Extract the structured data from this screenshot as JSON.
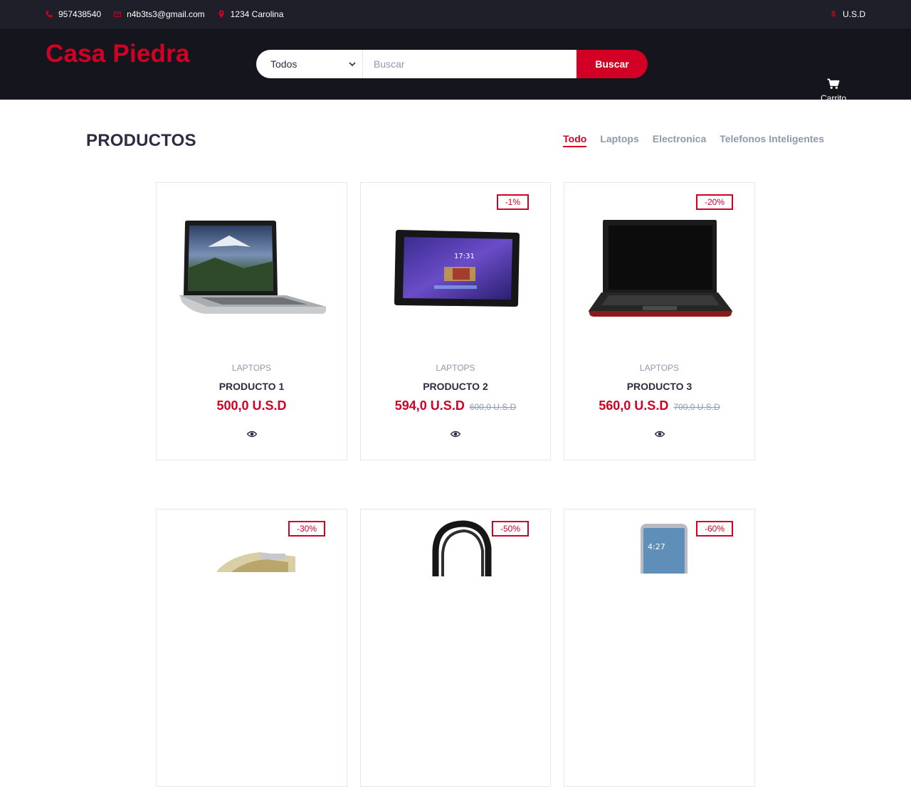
{
  "topbar": {
    "phone": "957438540",
    "email": "n4b3ts3@gmail.com",
    "address": "1234 Carolina",
    "currency": "U.S.D",
    "icons": {
      "phone": "phone-icon",
      "email": "envelope-icon",
      "address": "map-marker-icon",
      "currency": "dollar-icon"
    }
  },
  "header": {
    "logo": "Casa Piedra",
    "search": {
      "category_selected": "Todos",
      "placeholder": "Buscar",
      "value": "",
      "button_label": "Buscar"
    },
    "cart_label": "Carrito"
  },
  "section": {
    "title": "PRODUCTOS",
    "tabs": [
      {
        "label": "Todo",
        "active": true
      },
      {
        "label": "Laptops",
        "active": false
      },
      {
        "label": "Electronica",
        "active": false
      },
      {
        "label": "Telefonos Inteligentes",
        "active": false
      }
    ]
  },
  "products": [
    {
      "badge": "",
      "category": "LAPTOPS",
      "name": "PRODUCTO 1",
      "price": "500,0 U.S.D",
      "old_price": "",
      "image": "macbook-laptop"
    },
    {
      "badge": "-1%",
      "category": "LAPTOPS",
      "name": "PRODUCTO 2",
      "price": "594,0 U.S.D",
      "old_price": "600,0 U.S.D",
      "image": "tablet"
    },
    {
      "badge": "-20%",
      "category": "LAPTOPS",
      "name": "PRODUCTO 3",
      "price": "560,0 U.S.D",
      "old_price": "700,0 U.S.D",
      "image": "black-laptop"
    },
    {
      "badge": "-30%",
      "category": "",
      "name": "",
      "price": "",
      "old_price": "",
      "image": "camera-film"
    },
    {
      "badge": "-50%",
      "category": "",
      "name": "",
      "price": "",
      "old_price": "",
      "image": "headphones"
    },
    {
      "badge": "-60%",
      "category": "",
      "name": "",
      "price": "",
      "old_price": "",
      "image": "smartphone"
    }
  ],
  "colors": {
    "accent": "#d10024",
    "topbar_bg": "#1e1f29",
    "header_bg": "#15161d",
    "muted": "#8d99ae",
    "dark": "#2b2d42"
  }
}
